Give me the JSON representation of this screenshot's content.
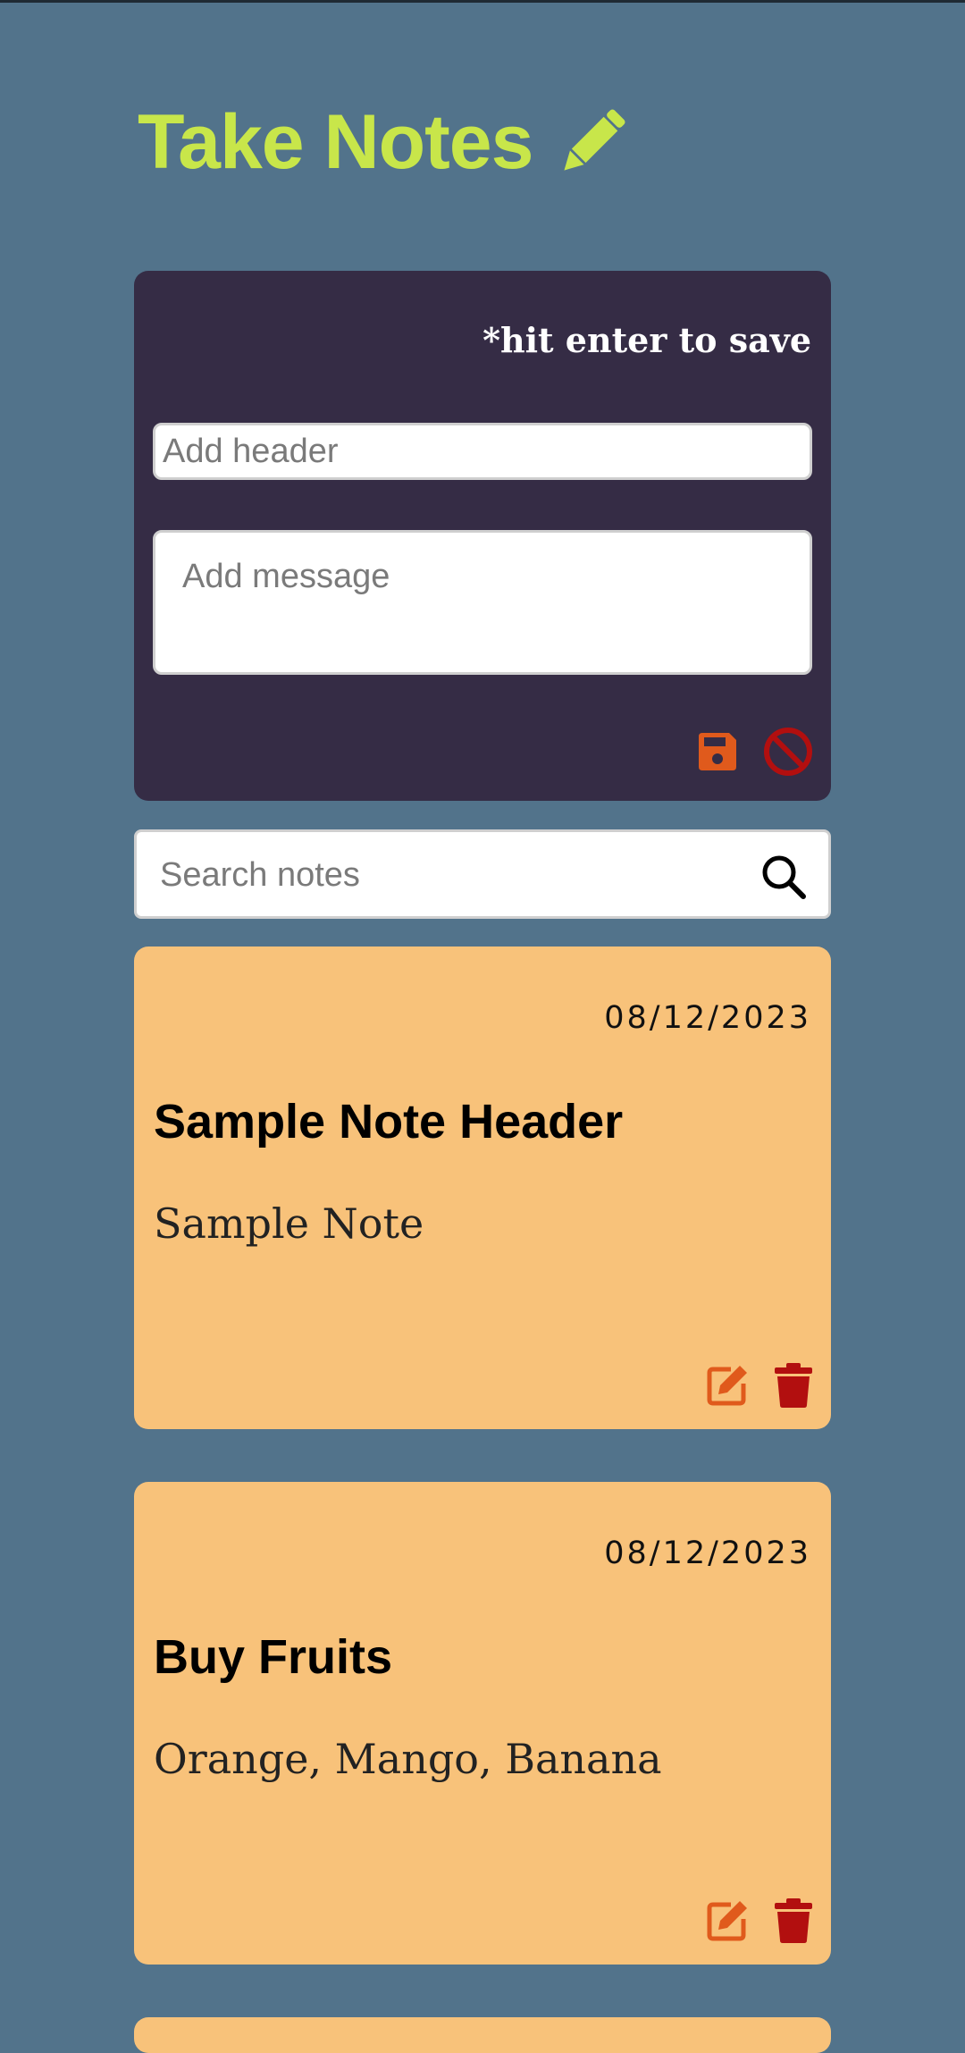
{
  "app": {
    "title": "Take Notes"
  },
  "composer": {
    "hint": "*hit enter to save",
    "header_placeholder": "Add header",
    "message_placeholder": "Add message"
  },
  "search": {
    "placeholder": "Search notes"
  },
  "notes": [
    {
      "date": "08/12/2023",
      "header": "Sample Note Header",
      "message": "Sample Note"
    },
    {
      "date": "08/12/2023",
      "header": "Buy Fruits",
      "message": "Orange, Mango, Banana"
    }
  ],
  "icons": {
    "title": "pencil-icon",
    "save": "save-icon",
    "cancel": "cancel-icon",
    "search": "search-icon",
    "edit": "edit-icon",
    "delete": "trash-icon"
  },
  "colors": {
    "background": "#52738b",
    "title": "#c8e64a",
    "composer_bg": "#352c45",
    "note_bg": "#f8c27a",
    "accent_orange": "#e05a1c",
    "danger_red": "#b20f0f"
  }
}
